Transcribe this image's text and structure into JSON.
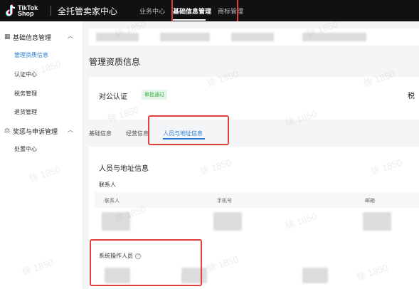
{
  "header": {
    "logo_text": "TikTok\nShop",
    "app_title": "全托管卖家中心",
    "nav": [
      {
        "label": "业务中心",
        "active": false
      },
      {
        "label": "基础信息管理",
        "active": true
      },
      {
        "label": "商标管理",
        "active": false
      }
    ]
  },
  "sidebar": {
    "groups": [
      {
        "label": "基础信息管理",
        "icon": "grid-icon",
        "items": [
          {
            "label": "管理资质信息",
            "active": true
          },
          {
            "label": "认证中心",
            "active": false
          },
          {
            "label": "税务管理",
            "active": false
          },
          {
            "label": "退货管理",
            "active": false
          }
        ]
      },
      {
        "label": "奖惩与申诉管理",
        "icon": "scale-icon",
        "items": [
          {
            "label": "处置中心",
            "active": false
          }
        ]
      }
    ]
  },
  "main": {
    "page_title": "管理资质信息",
    "auth": {
      "label": "对公认证",
      "status": "审批通过",
      "right_label": "税"
    },
    "tabs": [
      {
        "label": "基础信息",
        "active": false
      },
      {
        "label": "经营信息",
        "active": false
      },
      {
        "label": "人员与地址信息",
        "active": true
      }
    ],
    "section": {
      "title": "人员与地址信息",
      "contacts_label": "联系人",
      "columns": [
        "联系人",
        "手机号",
        "邮箱"
      ],
      "operators_label": "系统操作人员",
      "operators_info_icon": "?"
    }
  },
  "watermark": "徐 1850",
  "colors": {
    "accent": "#2a7cd6",
    "highlight": "#e04040",
    "success": "#3aaa4a",
    "topbar": "#111111"
  }
}
